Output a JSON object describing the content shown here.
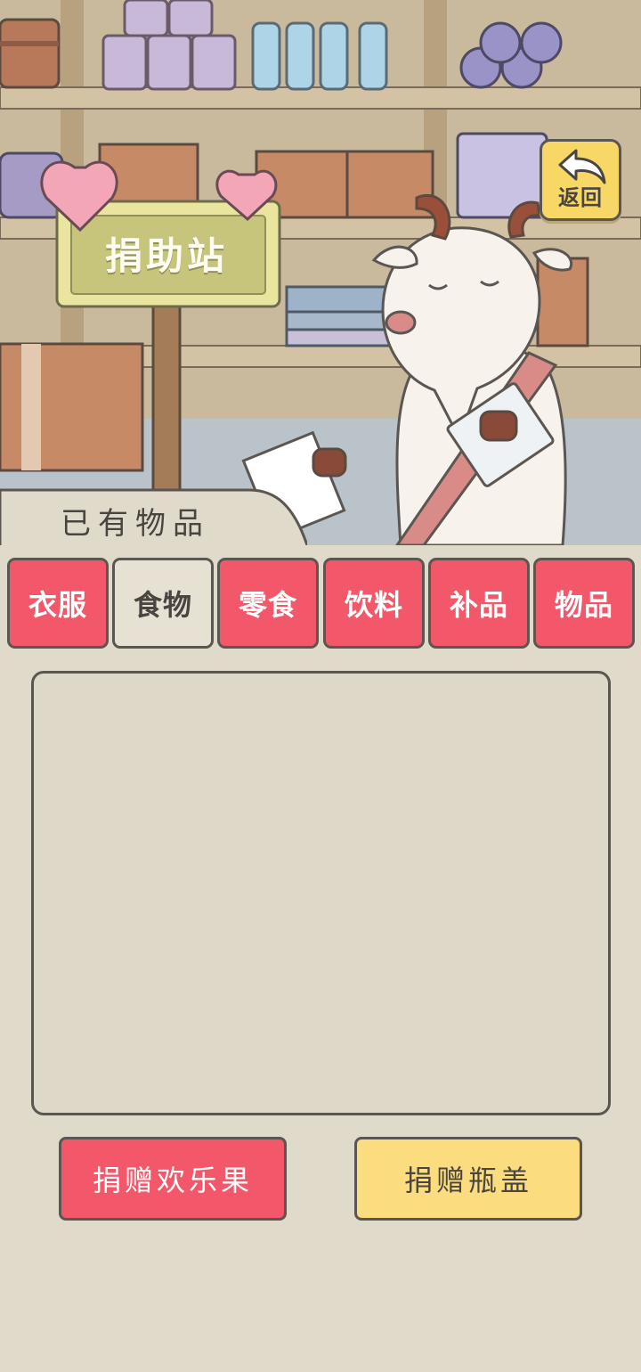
{
  "header": {
    "sign_title": "捐助站",
    "back_label": "返回",
    "back_icon": "return-arrow-icon"
  },
  "inventory": {
    "label": "已有物品",
    "tabs": [
      {
        "label": "衣服",
        "active": false
      },
      {
        "label": "食物",
        "active": true
      },
      {
        "label": "零食",
        "active": false
      },
      {
        "label": "饮料",
        "active": false
      },
      {
        "label": "补品",
        "active": false
      },
      {
        "label": "物品",
        "active": false
      }
    ]
  },
  "actions": {
    "donate_fruit": "捐赠欢乐果",
    "donate_caps": "捐赠瓶盖"
  },
  "colors": {
    "accent_red": "#f2586a",
    "accent_yellow": "#fbdc7f",
    "panel_bg": "#e0dacb",
    "outline": "#5b5651"
  }
}
